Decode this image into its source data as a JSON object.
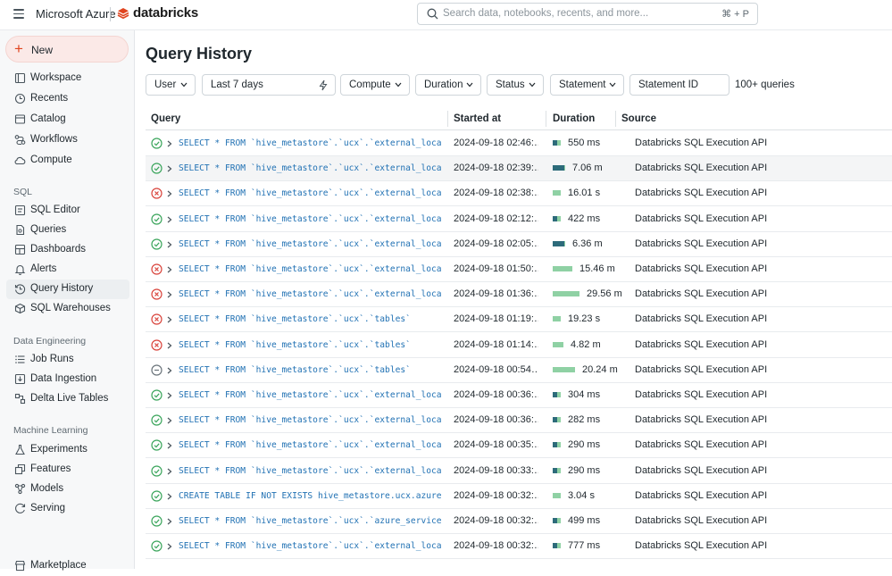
{
  "topbar": {
    "product": "Microsoft Azure",
    "brand": "databricks",
    "search_placeholder": "Search data, notebooks, recents, and more...",
    "search_shortcut": "⌘ + P"
  },
  "sidebar": {
    "new_label": "New",
    "items": [
      {
        "label": "Workspace",
        "icon": "folder-icon"
      },
      {
        "label": "Recents",
        "icon": "clock-icon"
      },
      {
        "label": "Catalog",
        "icon": "catalog-icon"
      },
      {
        "label": "Workflows",
        "icon": "workflows-icon"
      },
      {
        "label": "Compute",
        "icon": "cloud-icon"
      }
    ],
    "sql_header": "SQL",
    "sql_items": [
      {
        "label": "SQL Editor",
        "icon": "editor-icon"
      },
      {
        "label": "Queries",
        "icon": "queries-icon"
      },
      {
        "label": "Dashboards",
        "icon": "dashboards-icon"
      },
      {
        "label": "Alerts",
        "icon": "bell-icon"
      },
      {
        "label": "Query History",
        "icon": "history-icon"
      },
      {
        "label": "SQL Warehouses",
        "icon": "warehouse-icon"
      }
    ],
    "de_header": "Data Engineering",
    "de_items": [
      {
        "label": "Job Runs",
        "icon": "job-runs-icon"
      },
      {
        "label": "Data Ingestion",
        "icon": "ingestion-icon"
      },
      {
        "label": "Delta Live Tables",
        "icon": "pipeline-icon"
      }
    ],
    "ml_header": "Machine Learning",
    "ml_items": [
      {
        "label": "Experiments",
        "icon": "flask-icon"
      },
      {
        "label": "Features",
        "icon": "features-icon"
      },
      {
        "label": "Models",
        "icon": "models-icon"
      },
      {
        "label": "Serving",
        "icon": "serving-icon"
      }
    ],
    "bottom_item": "Marketplace"
  },
  "page": {
    "title": "Query History",
    "filters": {
      "user": "User",
      "date_range": "Last 7 days",
      "compute": "Compute",
      "duration": "Duration",
      "status": "Status",
      "statement": "Statement",
      "statement_id_placeholder": "Statement ID"
    },
    "count": "100+ queries",
    "columns": {
      "query": "Query",
      "started": "Started at",
      "duration": "Duration",
      "source": "Source"
    },
    "rows": [
      {
        "status": "success",
        "query": "SELECT * FROM `hive_metastore`.`ucx`.`external_locations`",
        "started": "2024-09-18 02:46:…",
        "duration": "550 ms",
        "bar_total": 0.12,
        "bar_dark": 0.5,
        "source": "Databricks SQL Execution API"
      },
      {
        "status": "success",
        "query": "SELECT * FROM `hive_metastore`.`ucx`.`external_locations`",
        "started": "2024-09-18 02:39:…",
        "duration": "7.06 m",
        "bar_total": 0.18,
        "bar_dark": 0.95,
        "source": "Databricks SQL Execution API"
      },
      {
        "status": "failed",
        "query": "SELECT * FROM `hive_metastore`.`ucx`.`external_locations`",
        "started": "2024-09-18 02:38:…",
        "duration": "16.01 s",
        "bar_total": 0.12,
        "bar_dark": 0.0,
        "source": "Databricks SQL Execution API"
      },
      {
        "status": "success",
        "query": "SELECT * FROM `hive_metastore`.`ucx`.`external_locations`",
        "started": "2024-09-18 02:12:…",
        "duration": "422 ms",
        "bar_total": 0.12,
        "bar_dark": 0.5,
        "source": "Databricks SQL Execution API"
      },
      {
        "status": "success",
        "query": "SELECT * FROM `hive_metastore`.`ucx`.`external_locations`",
        "started": "2024-09-18 02:05:…",
        "duration": "6.36 m",
        "bar_total": 0.18,
        "bar_dark": 0.95,
        "source": "Databricks SQL Execution API"
      },
      {
        "status": "failed",
        "query": "SELECT * FROM `hive_metastore`.`ucx`.`external_locations`",
        "started": "2024-09-18 01:50:…",
        "duration": "15.46 m",
        "bar_total": 0.28,
        "bar_dark": 0.0,
        "source": "Databricks SQL Execution API"
      },
      {
        "status": "failed",
        "query": "SELECT * FROM `hive_metastore`.`ucx`.`external_locations`",
        "started": "2024-09-18 01:36:…",
        "duration": "29.56 m",
        "bar_total": 0.38,
        "bar_dark": 0.0,
        "source": "Databricks SQL Execution API"
      },
      {
        "status": "failed",
        "query": "SELECT * FROM `hive_metastore`.`ucx`.`tables`",
        "started": "2024-09-18 01:19:…",
        "duration": "19.23 s",
        "bar_total": 0.12,
        "bar_dark": 0.0,
        "source": "Databricks SQL Execution API"
      },
      {
        "status": "failed",
        "query": "SELECT * FROM `hive_metastore`.`ucx`.`tables`",
        "started": "2024-09-18 01:14:…",
        "duration": "4.82 m",
        "bar_total": 0.16,
        "bar_dark": 0.0,
        "source": "Databricks SQL Execution API"
      },
      {
        "status": "canceled",
        "query": "SELECT * FROM `hive_metastore`.`ucx`.`tables`",
        "started": "2024-09-18 00:54…",
        "duration": "20.24 m",
        "bar_total": 0.32,
        "bar_dark": 0.0,
        "source": "Databricks SQL Execution API"
      },
      {
        "status": "success",
        "query": "SELECT * FROM `hive_metastore`.`ucx`.`external_locations`",
        "started": "2024-09-18 00:36:…",
        "duration": "304 ms",
        "bar_total": 0.12,
        "bar_dark": 0.5,
        "source": "Databricks SQL Execution API"
      },
      {
        "status": "success",
        "query": "SELECT * FROM `hive_metastore`.`ucx`.`external_locations`",
        "started": "2024-09-18 00:36:…",
        "duration": "282 ms",
        "bar_total": 0.12,
        "bar_dark": 0.5,
        "source": "Databricks SQL Execution API"
      },
      {
        "status": "success",
        "query": "SELECT * FROM `hive_metastore`.`ucx`.`external_locations`",
        "started": "2024-09-18 00:35:…",
        "duration": "290 ms",
        "bar_total": 0.12,
        "bar_dark": 0.5,
        "source": "Databricks SQL Execution API"
      },
      {
        "status": "success",
        "query": "SELECT * FROM `hive_metastore`.`ucx`.`external_locations`",
        "started": "2024-09-18 00:33:…",
        "duration": "290 ms",
        "bar_total": 0.12,
        "bar_dark": 0.5,
        "source": "Databricks SQL Execution API"
      },
      {
        "status": "success",
        "query": "CREATE TABLE IF NOT EXISTS hive_metastore.ucx.azure_serv…",
        "started": "2024-09-18 00:32:…",
        "duration": "3.04 s",
        "bar_total": 0.12,
        "bar_dark": 0.0,
        "source": "Databricks SQL Execution API"
      },
      {
        "status": "success",
        "query": "SELECT * FROM `hive_metastore`.`ucx`.`azure_service_prin…",
        "started": "2024-09-18 00:32:…",
        "duration": "499 ms",
        "bar_total": 0.12,
        "bar_dark": 0.5,
        "source": "Databricks SQL Execution API"
      },
      {
        "status": "success",
        "query": "SELECT * FROM `hive_metastore`.`ucx`.`external_locations`",
        "started": "2024-09-18 00:32:…",
        "duration": "777 ms",
        "bar_total": 0.12,
        "bar_dark": 0.5,
        "source": "Databricks SQL Execution API"
      }
    ]
  },
  "colors": {
    "accent_red": "#e0441f",
    "success": "#3ba55c",
    "failed": "#d9443c",
    "canceled": "#6b747b",
    "bar_dark": "#2d6b7a",
    "bar_light": "#8fd1a4",
    "link_blue": "#2272b4"
  }
}
